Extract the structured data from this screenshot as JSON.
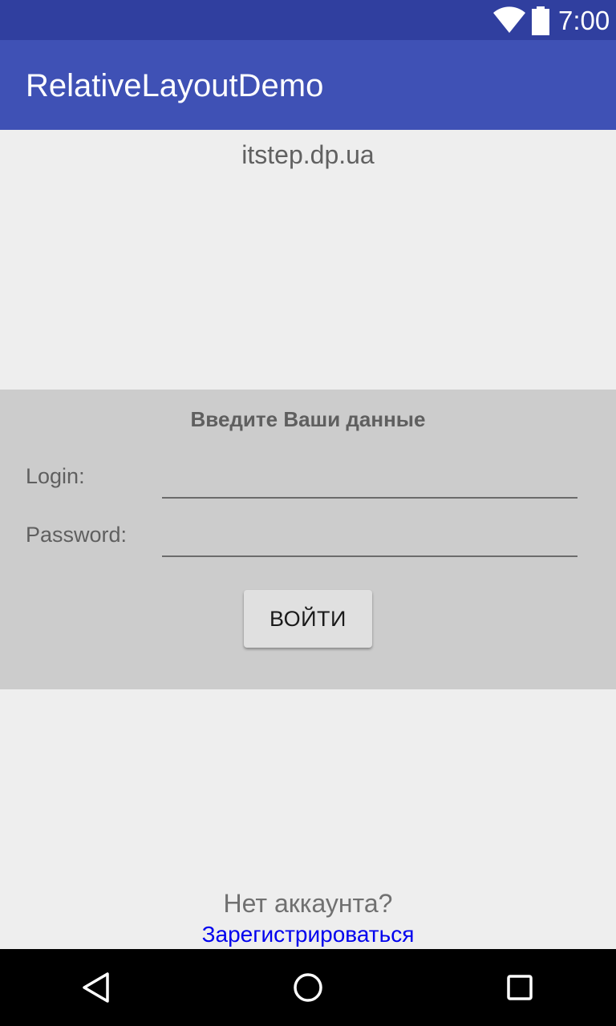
{
  "status_bar": {
    "time": "7:00",
    "icons": [
      "wifi-icon",
      "battery-icon"
    ]
  },
  "app_bar": {
    "title": "RelativeLayoutDemo",
    "color": "#3f51b5"
  },
  "site_label": "itstep.dp.ua",
  "login_form": {
    "heading": "Введите Ваши данные",
    "login_label": "Login:",
    "login_value": "",
    "password_label": "Password:",
    "password_value": "",
    "submit_label": "ВОЙТИ"
  },
  "footer": {
    "prompt": "Нет аккаунта?",
    "register_link": "Зарегистрироваться",
    "link_color": "#0000ee"
  },
  "nav_bar": {
    "icons": [
      "back-icon",
      "home-icon",
      "recents-icon"
    ]
  }
}
